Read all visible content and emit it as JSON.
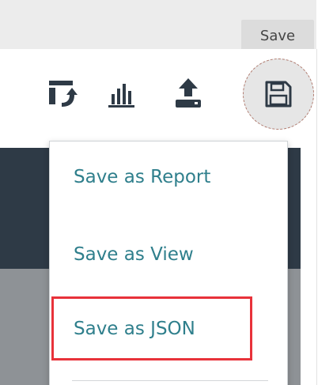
{
  "tooltip": {
    "text": "Save"
  },
  "toolbar": {
    "icons": [
      {
        "name": "pivot-icon"
      },
      {
        "name": "bar-chart-icon"
      },
      {
        "name": "upload-icon"
      },
      {
        "name": "save-icon"
      }
    ]
  },
  "save_menu": {
    "items": [
      {
        "label": "Save as Report"
      },
      {
        "label": "Save as View"
      },
      {
        "label": "Save as JSON"
      }
    ]
  },
  "colors": {
    "accent": "#2f7f8c",
    "highlight": "#e8323a",
    "dark_panel": "#2e3a46",
    "icon": "#2e3a46"
  }
}
